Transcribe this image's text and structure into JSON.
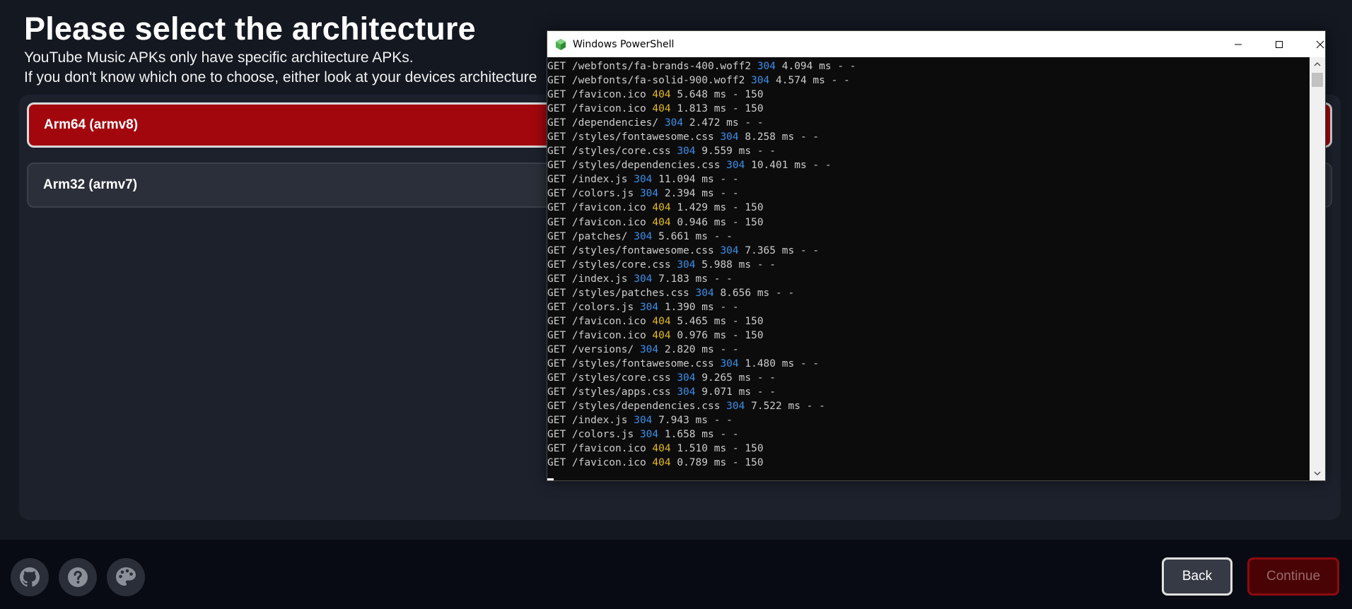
{
  "header": {
    "title": "Please select the architecture",
    "subtitle_line1": "YouTube Music APKs only have specific architecture APKs.",
    "subtitle_line2": "If you don't know which one to choose, either look at your devices architecture"
  },
  "options": [
    {
      "label": "Arm64 (armv8)",
      "selected": true
    },
    {
      "label": "Arm32 (armv7)",
      "selected": false
    }
  ],
  "footer": {
    "icons": [
      "github-icon",
      "question-icon",
      "palette-icon"
    ],
    "back_label": "Back",
    "continue_label": "Continue"
  },
  "powershell": {
    "title": "Windows PowerShell",
    "lines": [
      {
        "method": "GET",
        "path": "/webfonts/fa-brands-400.woff2",
        "status": "304",
        "rest": "4.094 ms - -"
      },
      {
        "method": "GET",
        "path": "/webfonts/fa-solid-900.woff2",
        "status": "304",
        "rest": "4.574 ms - -"
      },
      {
        "method": "GET",
        "path": "/favicon.ico",
        "status": "404",
        "rest": "5.648 ms - 150"
      },
      {
        "method": "GET",
        "path": "/favicon.ico",
        "status": "404",
        "rest": "1.813 ms - 150"
      },
      {
        "method": "GET",
        "path": "/dependencies/",
        "status": "304",
        "rest": "2.472 ms - -"
      },
      {
        "method": "GET",
        "path": "/styles/fontawesome.css",
        "status": "304",
        "rest": "8.258 ms - -"
      },
      {
        "method": "GET",
        "path": "/styles/core.css",
        "status": "304",
        "rest": "9.559 ms - -"
      },
      {
        "method": "GET",
        "path": "/styles/dependencies.css",
        "status": "304",
        "rest": "10.401 ms - -"
      },
      {
        "method": "GET",
        "path": "/index.js",
        "status": "304",
        "rest": "11.094 ms - -"
      },
      {
        "method": "GET",
        "path": "/colors.js",
        "status": "304",
        "rest": "2.394 ms - -"
      },
      {
        "method": "GET",
        "path": "/favicon.ico",
        "status": "404",
        "rest": "1.429 ms - 150"
      },
      {
        "method": "GET",
        "path": "/favicon.ico",
        "status": "404",
        "rest": "0.946 ms - 150"
      },
      {
        "method": "GET",
        "path": "/patches/",
        "status": "304",
        "rest": "5.661 ms - -"
      },
      {
        "method": "GET",
        "path": "/styles/fontawesome.css",
        "status": "304",
        "rest": "7.365 ms - -"
      },
      {
        "method": "GET",
        "path": "/styles/core.css",
        "status": "304",
        "rest": "5.988 ms - -"
      },
      {
        "method": "GET",
        "path": "/index.js",
        "status": "304",
        "rest": "7.183 ms - -"
      },
      {
        "method": "GET",
        "path": "/styles/patches.css",
        "status": "304",
        "rest": "8.656 ms - -"
      },
      {
        "method": "GET",
        "path": "/colors.js",
        "status": "304",
        "rest": "1.390 ms - -"
      },
      {
        "method": "GET",
        "path": "/favicon.ico",
        "status": "404",
        "rest": "5.465 ms - 150"
      },
      {
        "method": "GET",
        "path": "/favicon.ico",
        "status": "404",
        "rest": "0.976 ms - 150"
      },
      {
        "method": "GET",
        "path": "/versions/",
        "status": "304",
        "rest": "2.820 ms - -"
      },
      {
        "method": "GET",
        "path": "/styles/fontawesome.css",
        "status": "304",
        "rest": "1.480 ms - -"
      },
      {
        "method": "GET",
        "path": "/styles/core.css",
        "status": "304",
        "rest": "9.265 ms - -"
      },
      {
        "method": "GET",
        "path": "/styles/apps.css",
        "status": "304",
        "rest": "9.071 ms - -"
      },
      {
        "method": "GET",
        "path": "/styles/dependencies.css",
        "status": "304",
        "rest": "7.522 ms - -"
      },
      {
        "method": "GET",
        "path": "/index.js",
        "status": "304",
        "rest": "7.943 ms - -"
      },
      {
        "method": "GET",
        "path": "/colors.js",
        "status": "304",
        "rest": "1.658 ms - -"
      },
      {
        "method": "GET",
        "path": "/favicon.ico",
        "status": "404",
        "rest": "1.510 ms - 150"
      },
      {
        "method": "GET",
        "path": "/favicon.ico",
        "status": "404",
        "rest": "0.789 ms - 150"
      }
    ]
  },
  "colors": {
    "accent": "#a3070e",
    "status_304": "#3b8eea",
    "status_404": "#e5b921"
  }
}
